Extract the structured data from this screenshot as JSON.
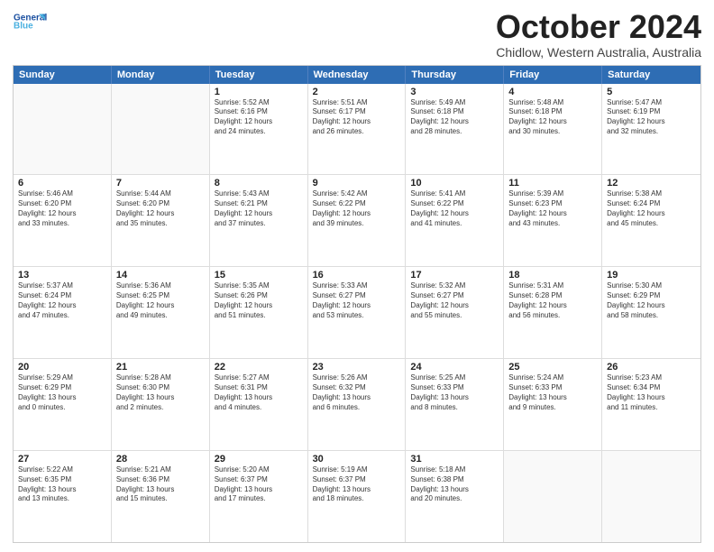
{
  "logo": {
    "line1": "General",
    "line2": "Blue"
  },
  "title": "October 2024",
  "location": "Chidlow, Western Australia, Australia",
  "weekdays": [
    "Sunday",
    "Monday",
    "Tuesday",
    "Wednesday",
    "Thursday",
    "Friday",
    "Saturday"
  ],
  "rows": [
    [
      {
        "day": "",
        "lines": []
      },
      {
        "day": "",
        "lines": []
      },
      {
        "day": "1",
        "lines": [
          "Sunrise: 5:52 AM",
          "Sunset: 6:16 PM",
          "Daylight: 12 hours",
          "and 24 minutes."
        ]
      },
      {
        "day": "2",
        "lines": [
          "Sunrise: 5:51 AM",
          "Sunset: 6:17 PM",
          "Daylight: 12 hours",
          "and 26 minutes."
        ]
      },
      {
        "day": "3",
        "lines": [
          "Sunrise: 5:49 AM",
          "Sunset: 6:18 PM",
          "Daylight: 12 hours",
          "and 28 minutes."
        ]
      },
      {
        "day": "4",
        "lines": [
          "Sunrise: 5:48 AM",
          "Sunset: 6:18 PM",
          "Daylight: 12 hours",
          "and 30 minutes."
        ]
      },
      {
        "day": "5",
        "lines": [
          "Sunrise: 5:47 AM",
          "Sunset: 6:19 PM",
          "Daylight: 12 hours",
          "and 32 minutes."
        ]
      }
    ],
    [
      {
        "day": "6",
        "lines": [
          "Sunrise: 5:46 AM",
          "Sunset: 6:20 PM",
          "Daylight: 12 hours",
          "and 33 minutes."
        ]
      },
      {
        "day": "7",
        "lines": [
          "Sunrise: 5:44 AM",
          "Sunset: 6:20 PM",
          "Daylight: 12 hours",
          "and 35 minutes."
        ]
      },
      {
        "day": "8",
        "lines": [
          "Sunrise: 5:43 AM",
          "Sunset: 6:21 PM",
          "Daylight: 12 hours",
          "and 37 minutes."
        ]
      },
      {
        "day": "9",
        "lines": [
          "Sunrise: 5:42 AM",
          "Sunset: 6:22 PM",
          "Daylight: 12 hours",
          "and 39 minutes."
        ]
      },
      {
        "day": "10",
        "lines": [
          "Sunrise: 5:41 AM",
          "Sunset: 6:22 PM",
          "Daylight: 12 hours",
          "and 41 minutes."
        ]
      },
      {
        "day": "11",
        "lines": [
          "Sunrise: 5:39 AM",
          "Sunset: 6:23 PM",
          "Daylight: 12 hours",
          "and 43 minutes."
        ]
      },
      {
        "day": "12",
        "lines": [
          "Sunrise: 5:38 AM",
          "Sunset: 6:24 PM",
          "Daylight: 12 hours",
          "and 45 minutes."
        ]
      }
    ],
    [
      {
        "day": "13",
        "lines": [
          "Sunrise: 5:37 AM",
          "Sunset: 6:24 PM",
          "Daylight: 12 hours",
          "and 47 minutes."
        ]
      },
      {
        "day": "14",
        "lines": [
          "Sunrise: 5:36 AM",
          "Sunset: 6:25 PM",
          "Daylight: 12 hours",
          "and 49 minutes."
        ]
      },
      {
        "day": "15",
        "lines": [
          "Sunrise: 5:35 AM",
          "Sunset: 6:26 PM",
          "Daylight: 12 hours",
          "and 51 minutes."
        ]
      },
      {
        "day": "16",
        "lines": [
          "Sunrise: 5:33 AM",
          "Sunset: 6:27 PM",
          "Daylight: 12 hours",
          "and 53 minutes."
        ]
      },
      {
        "day": "17",
        "lines": [
          "Sunrise: 5:32 AM",
          "Sunset: 6:27 PM",
          "Daylight: 12 hours",
          "and 55 minutes."
        ]
      },
      {
        "day": "18",
        "lines": [
          "Sunrise: 5:31 AM",
          "Sunset: 6:28 PM",
          "Daylight: 12 hours",
          "and 56 minutes."
        ]
      },
      {
        "day": "19",
        "lines": [
          "Sunrise: 5:30 AM",
          "Sunset: 6:29 PM",
          "Daylight: 12 hours",
          "and 58 minutes."
        ]
      }
    ],
    [
      {
        "day": "20",
        "lines": [
          "Sunrise: 5:29 AM",
          "Sunset: 6:29 PM",
          "Daylight: 13 hours",
          "and 0 minutes."
        ]
      },
      {
        "day": "21",
        "lines": [
          "Sunrise: 5:28 AM",
          "Sunset: 6:30 PM",
          "Daylight: 13 hours",
          "and 2 minutes."
        ]
      },
      {
        "day": "22",
        "lines": [
          "Sunrise: 5:27 AM",
          "Sunset: 6:31 PM",
          "Daylight: 13 hours",
          "and 4 minutes."
        ]
      },
      {
        "day": "23",
        "lines": [
          "Sunrise: 5:26 AM",
          "Sunset: 6:32 PM",
          "Daylight: 13 hours",
          "and 6 minutes."
        ]
      },
      {
        "day": "24",
        "lines": [
          "Sunrise: 5:25 AM",
          "Sunset: 6:33 PM",
          "Daylight: 13 hours",
          "and 8 minutes."
        ]
      },
      {
        "day": "25",
        "lines": [
          "Sunrise: 5:24 AM",
          "Sunset: 6:33 PM",
          "Daylight: 13 hours",
          "and 9 minutes."
        ]
      },
      {
        "day": "26",
        "lines": [
          "Sunrise: 5:23 AM",
          "Sunset: 6:34 PM",
          "Daylight: 13 hours",
          "and 11 minutes."
        ]
      }
    ],
    [
      {
        "day": "27",
        "lines": [
          "Sunrise: 5:22 AM",
          "Sunset: 6:35 PM",
          "Daylight: 13 hours",
          "and 13 minutes."
        ]
      },
      {
        "day": "28",
        "lines": [
          "Sunrise: 5:21 AM",
          "Sunset: 6:36 PM",
          "Daylight: 13 hours",
          "and 15 minutes."
        ]
      },
      {
        "day": "29",
        "lines": [
          "Sunrise: 5:20 AM",
          "Sunset: 6:37 PM",
          "Daylight: 13 hours",
          "and 17 minutes."
        ]
      },
      {
        "day": "30",
        "lines": [
          "Sunrise: 5:19 AM",
          "Sunset: 6:37 PM",
          "Daylight: 13 hours",
          "and 18 minutes."
        ]
      },
      {
        "day": "31",
        "lines": [
          "Sunrise: 5:18 AM",
          "Sunset: 6:38 PM",
          "Daylight: 13 hours",
          "and 20 minutes."
        ]
      },
      {
        "day": "",
        "lines": []
      },
      {
        "day": "",
        "lines": []
      }
    ]
  ]
}
